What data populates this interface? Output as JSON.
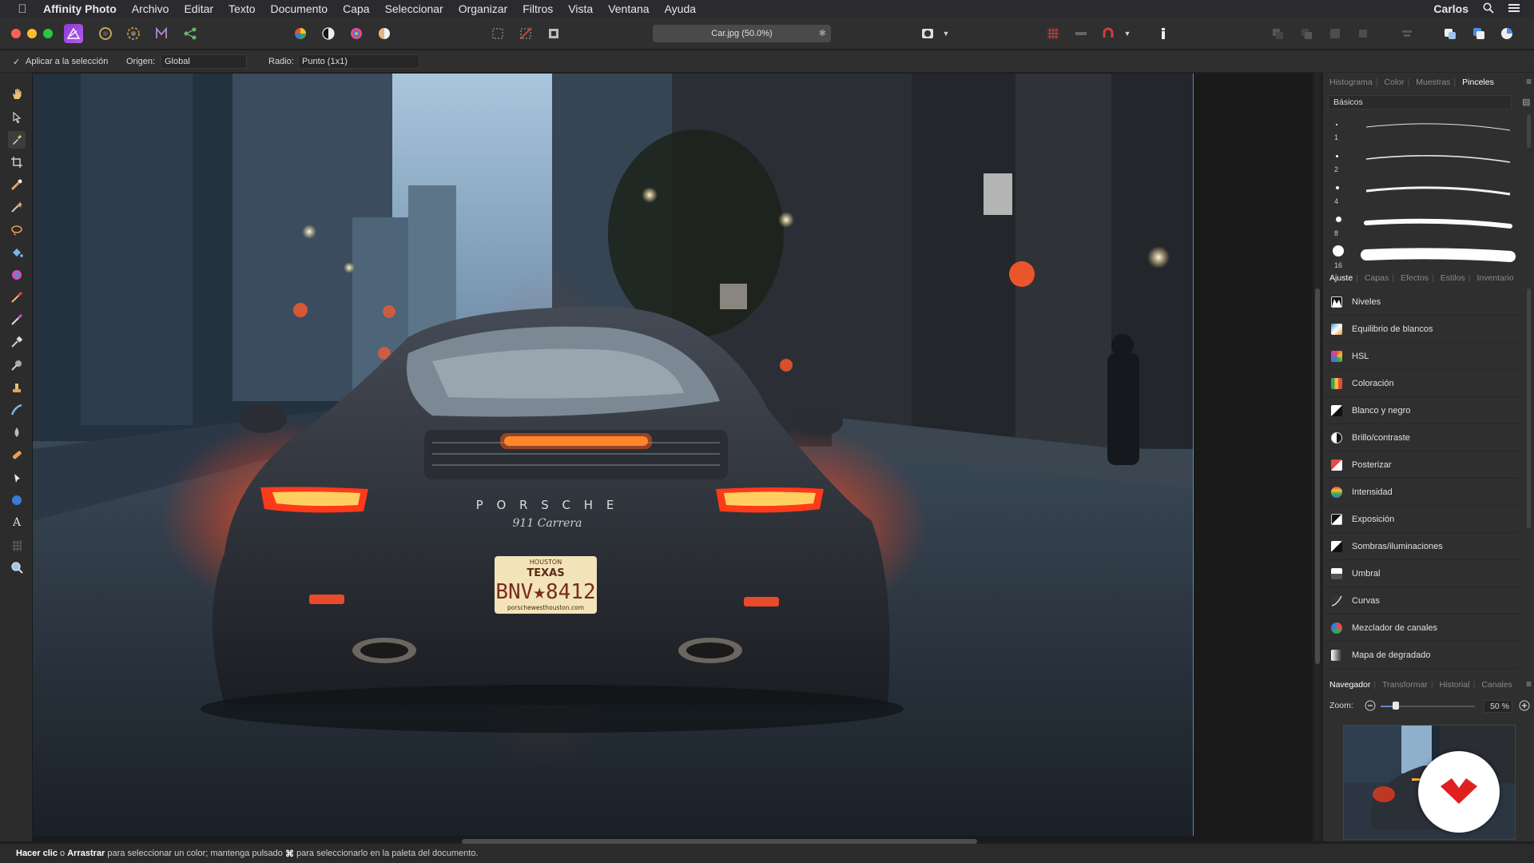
{
  "menubar": {
    "app_name": "Affinity Photo",
    "items": [
      "Archivo",
      "Editar",
      "Texto",
      "Documento",
      "Capa",
      "Seleccionar",
      "Organizar",
      "Filtros",
      "Vista",
      "Ventana",
      "Ayuda"
    ],
    "user": "Carlos"
  },
  "toolbar": {
    "document_title": "Car.jpg (50.0%)"
  },
  "context": {
    "apply_label": "Aplicar a la selección",
    "origin_label": "Origen:",
    "origin_value": "Global",
    "radius_label": "Radio:",
    "radius_value": "Punto (1x1)"
  },
  "top_panel": {
    "tabs": [
      "Histograma",
      "Color",
      "Muestras",
      "Pinceles"
    ],
    "active_tab": "Pinceles",
    "category": "Básicos",
    "brush_sizes": [
      "1",
      "2",
      "4",
      "8",
      "16"
    ]
  },
  "mid_panel": {
    "tabs": [
      "Ajuste",
      "Capas",
      "Efectos",
      "Estilos",
      "Inventario"
    ],
    "active_tab": "Ajuste",
    "adjustments": [
      {
        "label": "Niveles",
        "icon": "levels-icon"
      },
      {
        "label": "Equilibrio de blancos",
        "icon": "white-balance-icon"
      },
      {
        "label": "HSL",
        "icon": "hsl-icon"
      },
      {
        "label": "Coloración",
        "icon": "recolor-icon"
      },
      {
        "label": "Blanco y negro",
        "icon": "black-white-icon"
      },
      {
        "label": "Brillo/contraste",
        "icon": "brightness-contrast-icon"
      },
      {
        "label": "Posterizar",
        "icon": "posterize-icon"
      },
      {
        "label": "Intensidad",
        "icon": "vibrance-icon"
      },
      {
        "label": "Exposición",
        "icon": "exposure-icon"
      },
      {
        "label": "Sombras/iluminaciones",
        "icon": "shadows-highlights-icon"
      },
      {
        "label": "Umbral",
        "icon": "threshold-icon"
      },
      {
        "label": "Curvas",
        "icon": "curves-icon"
      },
      {
        "label": "Mezclador de canales",
        "icon": "channel-mixer-icon"
      },
      {
        "label": "Mapa de degradado",
        "icon": "gradient-map-icon"
      }
    ]
  },
  "bottom_panel": {
    "tabs": [
      "Navegador",
      "Transformar",
      "Historial",
      "Canales"
    ],
    "active_tab": "Navegador",
    "zoom_label": "Zoom:",
    "zoom_value": "50 %",
    "zoom_fraction": 0.5
  },
  "photo": {
    "brand_text": "P O R S C H E",
    "model_text": "911 Carrera",
    "plate_state": "TEXAS",
    "plate_city": "HOUSTON",
    "plate_number": "BNV★8412",
    "plate_url": "porschewesthouston.com"
  },
  "statusbar": {
    "click": "Hacer clic",
    "or": " o ",
    "drag": "Arrastrar",
    "rest": " para seleccionar un color; mantenga pulsado ",
    "cmd": "⌘",
    "rest2": " para seleccionarlo en la paleta del documento."
  },
  "colors": {
    "accent": "#5a87c6",
    "menubar_bg": "#2b2a2e",
    "panel_bg": "#2f2f2f",
    "taillight": "#ff3a1a",
    "badge_red": "#e01f1f"
  }
}
